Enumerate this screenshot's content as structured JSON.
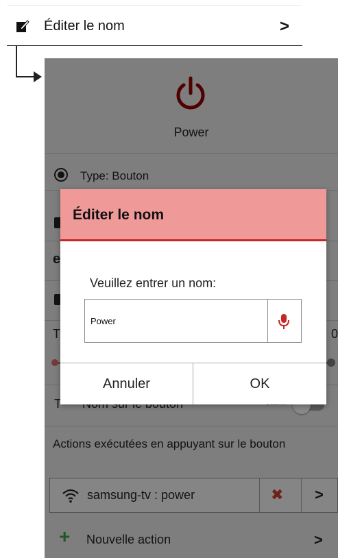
{
  "context_row": {
    "label": "Éditer le nom",
    "chevron": ">"
  },
  "screen": {
    "power_label": "Power",
    "type_label": "Type: Bouton",
    "partial_t": "T",
    "partial_zero": "0",
    "name_on_button_label": "Nom sur le bouton",
    "hide_label": "Cacher",
    "actions_label": "Actions exécutées en appuyant sur le bouton",
    "action": {
      "label": "samsung-tv : power",
      "delete": "✖",
      "chevron": ">"
    },
    "new_action": {
      "plus": "+",
      "label": "Nouvelle action",
      "chevron": ">"
    }
  },
  "dialog": {
    "title": "Éditer le nom",
    "prompt": "Veuillez entrer un nom:",
    "input_value": "Power",
    "cancel_label": "Annuler",
    "ok_label": "OK"
  },
  "colors": {
    "accent": "#c62828",
    "dialog_header": "#ef9a99",
    "add_green": "#3a9a3a"
  }
}
